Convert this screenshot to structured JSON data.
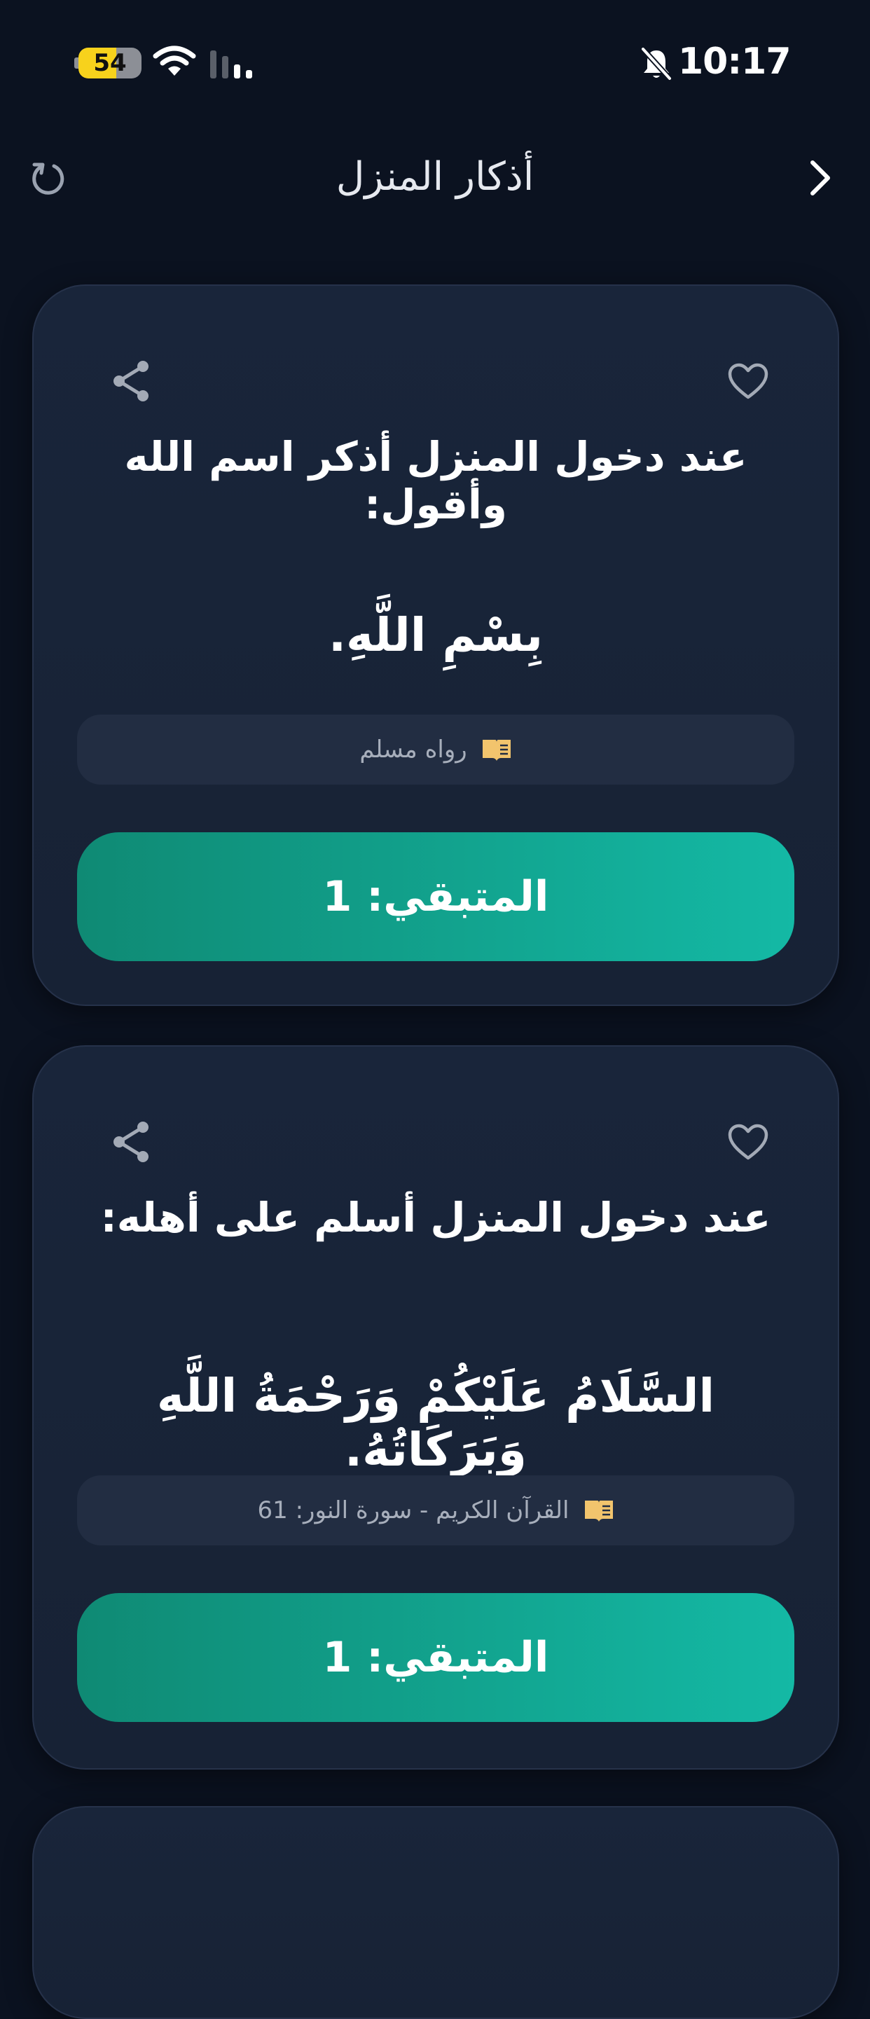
{
  "status_bar": {
    "battery_level": "54",
    "time": "10:17"
  },
  "header": {
    "title": "أذكار المنزل"
  },
  "cards": [
    {
      "heading": "عند دخول المنزل أذكر اسم الله وأقول:",
      "text": "بِسْمِ اللَّهِ.",
      "source": "رواه مسلم",
      "counter": "المتبقي: 1"
    },
    {
      "heading": "عند دخول المنزل أسلم على أهله:",
      "text": "السَّلَامُ عَلَيْكُمْ وَرَحْمَةُ اللَّهِ وَبَرَكَاتُهُ.",
      "source": "القرآن الكريم - سورة النور: 61",
      "counter": "المتبقي: 1"
    }
  ],
  "icons": {
    "refresh": "refresh-icon",
    "forward": "chevron-right-icon",
    "share": "share-icon",
    "favorite": "heart-icon",
    "source": "book-icon",
    "muted": "bell-slash-icon",
    "wifi": "wifi-icon",
    "cellular": "cellular-signal-icon"
  },
  "colors": {
    "background": "#0b1220",
    "card": "#19253a",
    "accent_start": "#0f8a74",
    "accent_end": "#14b9a5",
    "book_icon": "#f2c46d"
  }
}
